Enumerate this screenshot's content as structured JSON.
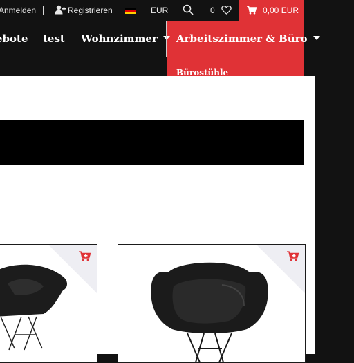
{
  "topbar": {
    "login_label": "Anmelden",
    "register_label": "Registrieren",
    "language_flag": "germany-flag-icon",
    "currency": "EUR",
    "wishlist_count": "0",
    "cart_total": "0,00 EUR"
  },
  "nav": {
    "items": [
      {
        "label": "ebote"
      },
      {
        "label": "test"
      },
      {
        "label": "Wohnzimmer"
      },
      {
        "label": "Arbeitszimmer & Büro"
      }
    ],
    "active_index": 3,
    "submenu": [
      {
        "label": "Bürostühle"
      }
    ]
  },
  "products": [
    {
      "icon": "add-to-cart-icon"
    },
    {
      "icon": "add-to-cart-icon"
    }
  ],
  "colors": {
    "accent": "#e03236",
    "bar": "#121212",
    "page": "#ffffff"
  }
}
